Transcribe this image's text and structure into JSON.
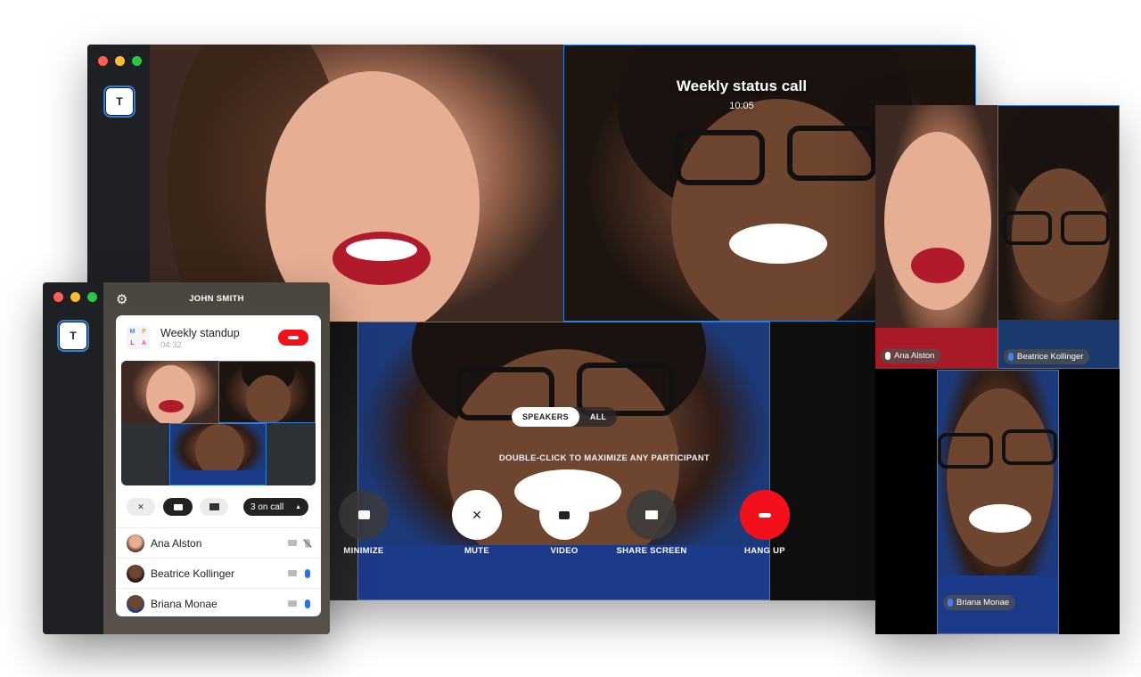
{
  "main_window": {
    "team_initial": "T",
    "call_title": "Weekly status call",
    "call_time": "10:05",
    "view_toggle": {
      "speakers": "SPEAKERS",
      "all": "ALL",
      "selected": "SPEAKERS"
    },
    "hint": "DOUBLE-CLICK TO MAXIMIZE ANY PARTICIPANT",
    "controls": [
      {
        "icon": "chat-icon",
        "label": "MINIMIZE"
      },
      {
        "icon": "mic-off-icon",
        "label": "MUTE"
      },
      {
        "icon": "video-icon",
        "label": "VIDEO"
      },
      {
        "icon": "screen-share-icon",
        "label": "SHARE SCREEN"
      },
      {
        "icon": "phone-hangup-icon",
        "label": "HANG UP"
      }
    ]
  },
  "right_window": {
    "tiles": [
      {
        "name": "Ana Alston"
      },
      {
        "name": "Beatrice Kollinger"
      },
      {
        "name": "Briana Monae"
      }
    ]
  },
  "small_window": {
    "team_initial": "T",
    "user_name": "JOHN SMITH",
    "meeting": {
      "logo_letters": [
        "M",
        "P",
        "L",
        "A"
      ],
      "name": "Weekly standup",
      "time": "04:32"
    },
    "on_call_label": "3 on call",
    "participants": [
      {
        "name": "Ana Alston",
        "mic": "muted"
      },
      {
        "name": "Beatrice Kollinger",
        "mic": "live"
      },
      {
        "name": "Briana Monae",
        "mic": "live"
      }
    ]
  },
  "colors": {
    "accent": "#2f7fd8",
    "hangup": "#f2111b"
  }
}
